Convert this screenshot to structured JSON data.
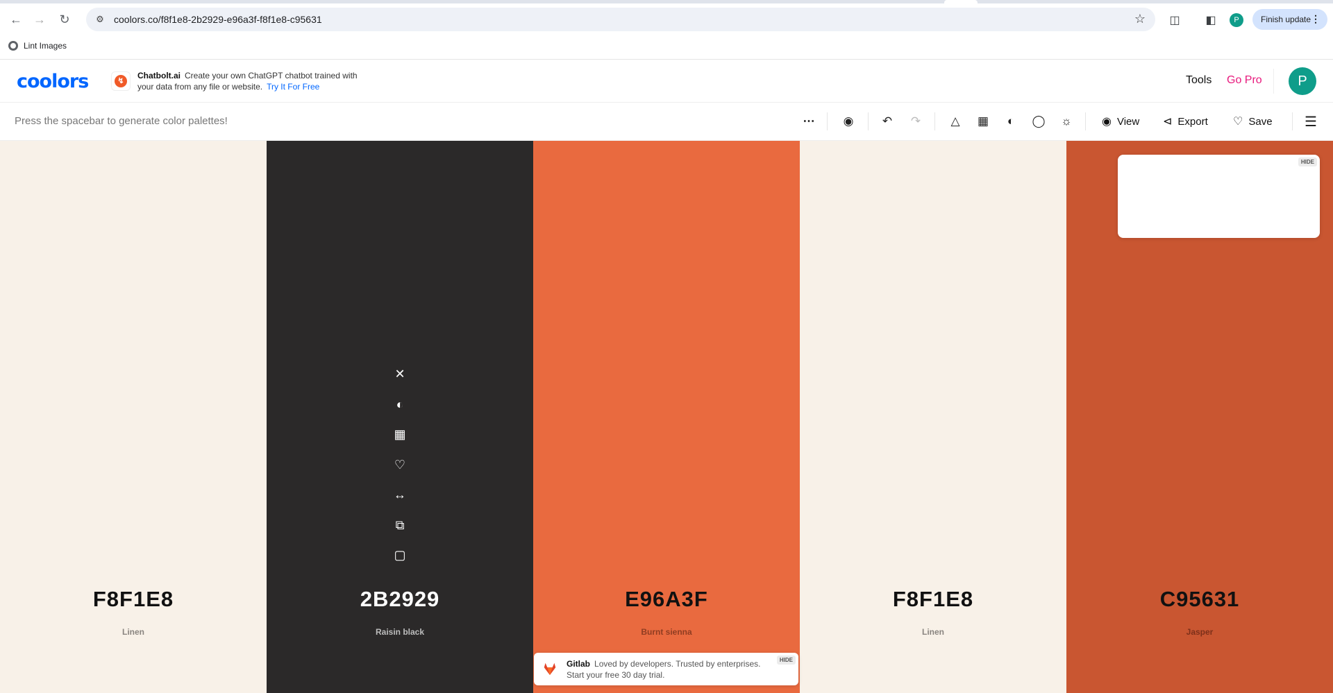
{
  "browser": {
    "url": "coolors.co/f8f1e8-2b2929-e96a3f-f8f1e8-c95631",
    "bookmark": "Lint Images",
    "profile_initial": "P",
    "finish_update": "Finish update"
  },
  "header": {
    "logo": "coolors",
    "ad": {
      "brand": "Chatbolt.ai",
      "text": "Create your own ChatGPT chatbot trained with your data from any file or website.",
      "cta": "Try It For Free"
    },
    "tools": "Tools",
    "go_pro": "Go Pro",
    "avatar_initial": "P"
  },
  "generator_bar": {
    "hint": "Press the spacebar to generate color palettes!",
    "view": "View",
    "export": "Export",
    "save": "Save"
  },
  "palette": [
    {
      "hex": "F8F1E8",
      "name": "Linen",
      "bg": "#f8f1e8",
      "fg": "#111111",
      "name_color": "#8a8580"
    },
    {
      "hex": "2B2929",
      "name": "Raisin black",
      "bg": "#2b2929",
      "fg": "#ffffff",
      "name_color": "#bdbdbd"
    },
    {
      "hex": "E96A3F",
      "name": "Burnt sienna",
      "bg": "#e96a3f",
      "fg": "#111111",
      "name_color": "#8f3d22"
    },
    {
      "hex": "F8F1E8",
      "name": "Linen",
      "bg": "#f8f1e8",
      "fg": "#111111",
      "name_color": "#8a8580"
    },
    {
      "hex": "C95631",
      "name": "Jasper",
      "bg": "#c95631",
      "fg": "#111111",
      "name_color": "#7d301a"
    }
  ],
  "ads": {
    "hide_label": "HIDE",
    "gitlab": {
      "brand": "Gitlab",
      "text": "Loved by developers. Trusted by enterprises. Start your free 30 day trial."
    }
  }
}
